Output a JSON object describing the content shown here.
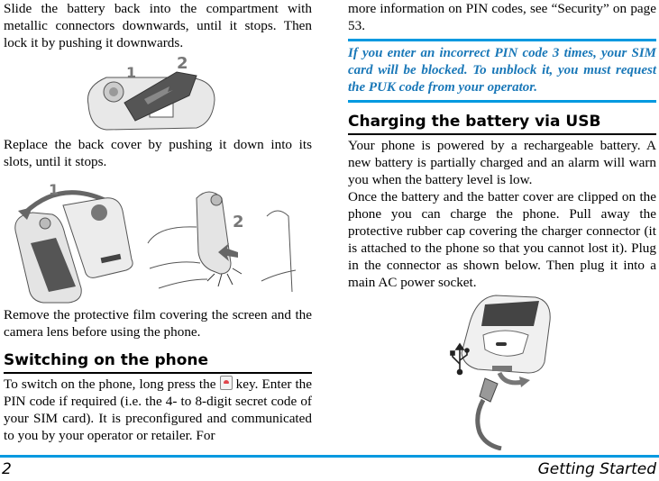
{
  "left_column": {
    "para_battery": "Slide the battery back into the compartment with metallic connectors downwards, until it stops. Then lock it by pushing it downwards.",
    "figure1": {
      "label_1": "1",
      "label_2": "2",
      "description": "battery-insertion-illustration"
    },
    "para_cover": "Replace the back cover by pushing it down into its slots, until it stops.",
    "figure2": {
      "label_1": "1",
      "label_2": "2",
      "description": "back-cover-replacement-illustration"
    },
    "para_film": "Remove the protective film covering the screen and the camera lens before using the phone.",
    "heading_switch_on": "Switching on the phone",
    "para_switch_on_before_icon": "To switch on the phone, long press the",
    "para_switch_on_after_icon": "key. Enter the PIN code if required (i.e. the 4- to 8-digit secret code of your SIM card). It is preconfigured and communicated to you by your operator or retailer. For"
  },
  "right_column": {
    "para_pin_cont": "more information on PIN codes, see “Security” on page 53.",
    "note_puk": "If you enter an incorrect PIN code 3 times, your SIM card will be blocked. To unblock it, you must request the PUK code from your operator.",
    "heading_usb": "Charging the battery via USB",
    "para_usb_1": "Your phone is powered by a rechargeable battery. A new battery is partially charged and an alarm will warn you when the battery level is low.",
    "para_usb_2": "Once the battery and the batter cover are clipped on the phone you can charge the phone. Pull away the protective rubber cap covering the charger connector (it is attached to the phone so that you cannot lost it). Plug in the connector as shown below. Then plug it into a main AC power socket.",
    "figure3": {
      "description": "usb-charging-illustration"
    }
  },
  "footer": {
    "page_number": "2",
    "chapter_title": "Getting Started"
  },
  "colors": {
    "accent_blue": "#0099e0",
    "note_text": "#1a78b8"
  }
}
